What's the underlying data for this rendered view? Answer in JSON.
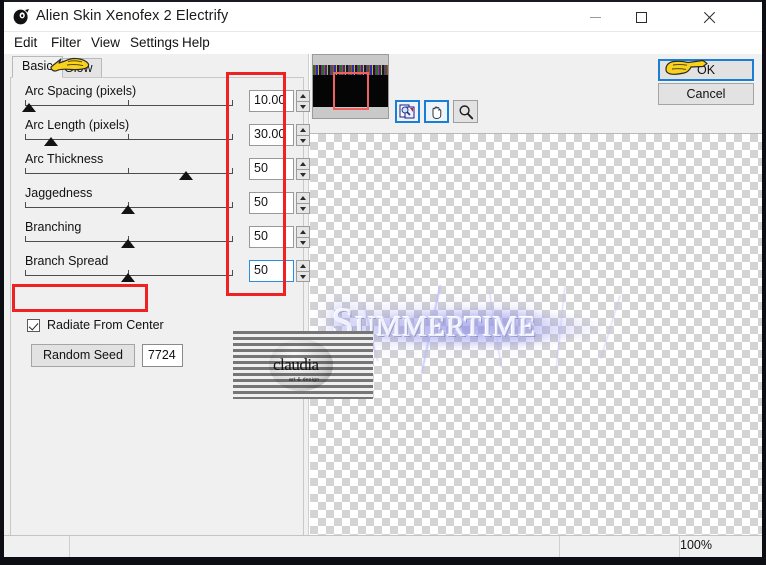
{
  "window": {
    "title": "Alien Skin Xenofex 2 Electrify",
    "icon": "alien-skin-icon",
    "controls": {
      "minimize": "minimize-icon",
      "maximize": "maximize-icon",
      "close": "close-icon"
    }
  },
  "menubar": {
    "items": [
      {
        "label": "Edit"
      },
      {
        "label": "Filter"
      },
      {
        "label": "View"
      },
      {
        "label": "Settings"
      },
      {
        "label": "Help"
      }
    ]
  },
  "tabs": [
    {
      "label": "Basic",
      "active": true
    },
    {
      "label": "Glow",
      "active": false
    }
  ],
  "parameters": [
    {
      "label": "Arc Spacing (pixels)",
      "value": "10.00",
      "thumb_pct": 3,
      "focused": false
    },
    {
      "label": "Arc Length (pixels)",
      "value": "30.00",
      "thumb_pct": 13,
      "focused": false
    },
    {
      "label": "Arc Thickness",
      "value": "50",
      "thumb_pct": 82,
      "focused": false
    },
    {
      "label": "Jaggedness",
      "value": "50",
      "thumb_pct": 50,
      "focused": false
    },
    {
      "label": "Branching",
      "value": "50",
      "thumb_pct": 50,
      "focused": false
    },
    {
      "label": "Branch Spread",
      "value": "50",
      "thumb_pct": 50,
      "focused": true
    }
  ],
  "checkbox": {
    "label": "Radiate From Center",
    "checked": true
  },
  "random_seed": {
    "button_label": "Random Seed",
    "value": "7724"
  },
  "buttons": {
    "ok": "OK",
    "cancel": "Cancel"
  },
  "preview_tools": [
    {
      "name": "navigator-icon",
      "selected": true
    },
    {
      "name": "hand-pan-icon",
      "selected": true
    },
    {
      "name": "zoom-magnifier-icon",
      "selected": false
    }
  ],
  "canvas": {
    "artwork_text": "Summertime",
    "watermark": {
      "name": "claudia",
      "sub": "art & design"
    }
  },
  "statusbar": {
    "zoom_level": "100%"
  },
  "annotations": {
    "highlight_color": "#ee2222",
    "focus_color": "#1a7fd4",
    "boxes": [
      {
        "name": "value-fields-highlight"
      },
      {
        "name": "radiate-checkbox-highlight"
      }
    ],
    "pointers": [
      {
        "name": "tab-pointer-hand"
      },
      {
        "name": "ok-pointer-hand"
      }
    ]
  }
}
